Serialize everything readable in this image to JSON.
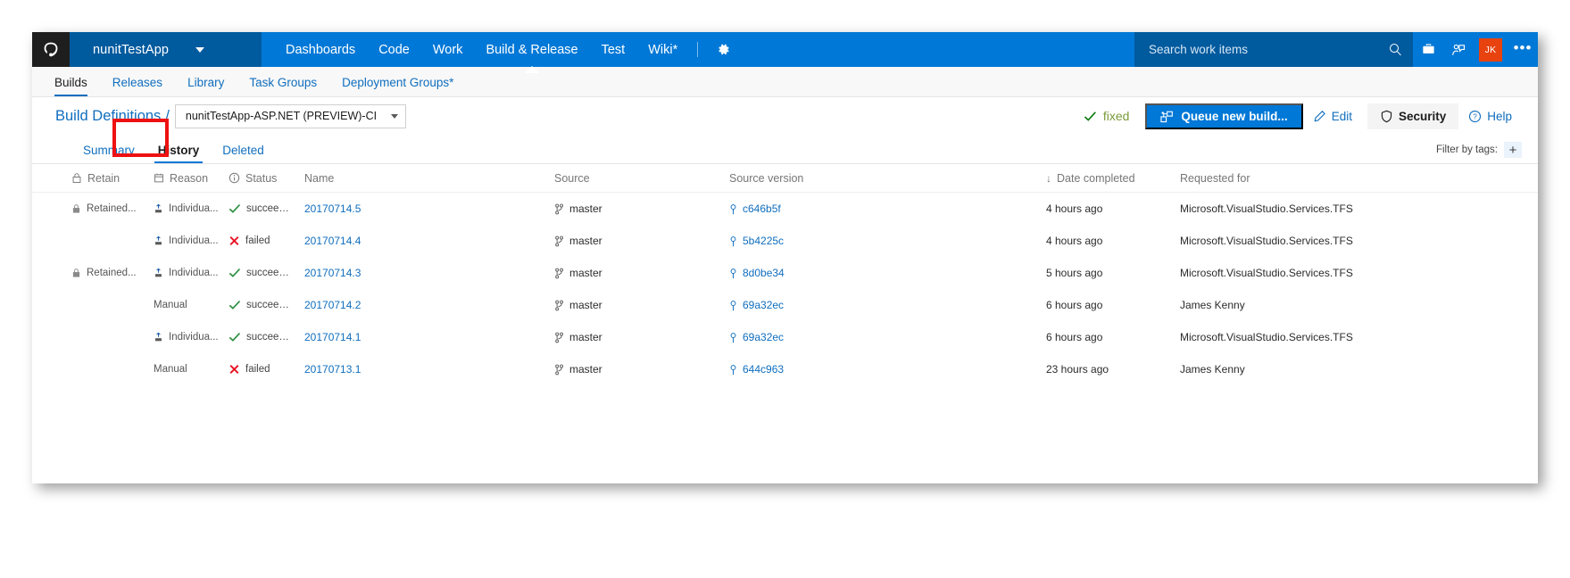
{
  "topbar": {
    "logo_icon": "azure-devops-logo-icon",
    "project_name": "nunitTestApp",
    "project_chevron_icon": "chevron-down-icon",
    "nav_items": [
      {
        "label": "Dashboards",
        "active": false
      },
      {
        "label": "Code",
        "active": false
      },
      {
        "label": "Work",
        "active": false
      },
      {
        "label": "Build & Release",
        "active": true
      },
      {
        "label": "Test",
        "active": false
      },
      {
        "label": "Wiki*",
        "active": false
      }
    ],
    "settings_icon": "gear-icon",
    "search": {
      "placeholder": "Search work items",
      "value": "",
      "icon": "search-icon"
    },
    "icons": [
      {
        "name": "marketplace-briefcase-icon"
      },
      {
        "name": "feedback-person-icon"
      }
    ],
    "avatar_initials": "JK",
    "avatar_color": "#e8430f",
    "more_label": "•••",
    "accent_color": "#0078d7",
    "project_bar_color": "#005a9e"
  },
  "hubnav": {
    "items": [
      {
        "label": "Builds",
        "active": true
      },
      {
        "label": "Releases",
        "active": false
      },
      {
        "label": "Library",
        "active": false
      },
      {
        "label": "Task Groups",
        "active": false
      },
      {
        "label": "Deployment Groups*",
        "active": false
      }
    ]
  },
  "breadcrumb": {
    "root_label": "Build Definitions",
    "separator": "/",
    "definition_name": "nunitTestApp-ASP.NET (PREVIEW)-CI",
    "picker_chevron_icon": "chevron-down-icon"
  },
  "toolbar": {
    "status_icon": "check-icon",
    "status_label": "fixed",
    "queue_icon": "queue-build-icon",
    "queue_label": "Queue new build...",
    "edit_icon": "pencil-icon",
    "edit_label": "Edit",
    "security_icon": "shield-icon",
    "security_label": "Security",
    "help_icon": "question-circle-icon",
    "help_label": "Help"
  },
  "pivots": {
    "items": [
      {
        "label": "Summary",
        "active": false
      },
      {
        "label": "History",
        "active": true
      },
      {
        "label": "Deleted",
        "active": false
      }
    ],
    "filter_label": "Filter by tags:",
    "filter_add_icon": "plus-icon",
    "annotation_color": "#ee1111"
  },
  "grid": {
    "columns": [
      {
        "label": "Retain",
        "icon": "lock-icon"
      },
      {
        "label": "Reason",
        "icon": "calendar-icon"
      },
      {
        "label": "Status",
        "icon": "info-circle-icon"
      },
      {
        "label": "Name",
        "icon": ""
      },
      {
        "label": "Source",
        "icon": ""
      },
      {
        "label": "Source version",
        "icon": ""
      },
      {
        "label": "Date completed",
        "icon": "sort-down-arrow-icon",
        "sorted": true
      },
      {
        "label": "Requested for",
        "icon": ""
      }
    ],
    "rows": [
      {
        "retain": "Retained...",
        "retain_icon": "lock-icon",
        "reason": "Individua...",
        "reason_icon": "upload-ci-icon",
        "status": "succee…",
        "status_icon": "check-icon",
        "status_state": "succeeded",
        "name": "20170714.5",
        "source": "master",
        "source_icon": "branch-icon",
        "version": "c646b5f",
        "version_icon": "commit-icon",
        "date": "4 hours ago",
        "requested_for": "Microsoft.VisualStudio.Services.TFS"
      },
      {
        "retain": "",
        "retain_icon": "",
        "reason": "Individua...",
        "reason_icon": "upload-ci-icon",
        "status": "failed",
        "status_icon": "x-icon",
        "status_state": "failed",
        "name": "20170714.4",
        "source": "master",
        "source_icon": "branch-icon",
        "version": "5b4225c",
        "version_icon": "commit-icon",
        "date": "4 hours ago",
        "requested_for": "Microsoft.VisualStudio.Services.TFS"
      },
      {
        "retain": "Retained...",
        "retain_icon": "lock-icon",
        "reason": "Individua...",
        "reason_icon": "upload-ci-icon",
        "status": "succee…",
        "status_icon": "check-icon",
        "status_state": "succeeded",
        "name": "20170714.3",
        "source": "master",
        "source_icon": "branch-icon",
        "version": "8d0be34",
        "version_icon": "commit-icon",
        "date": "5 hours ago",
        "requested_for": "Microsoft.VisualStudio.Services.TFS"
      },
      {
        "retain": "",
        "retain_icon": "",
        "reason": "Manual",
        "reason_icon": "",
        "status": "succee…",
        "status_icon": "check-icon",
        "status_state": "succeeded",
        "name": "20170714.2",
        "source": "master",
        "source_icon": "branch-icon",
        "version": "69a32ec",
        "version_icon": "commit-icon",
        "date": "6 hours ago",
        "requested_for": "James Kenny"
      },
      {
        "retain": "",
        "retain_icon": "",
        "reason": "Individua...",
        "reason_icon": "upload-ci-icon",
        "status": "succee…",
        "status_icon": "check-icon",
        "status_state": "succeeded",
        "name": "20170714.1",
        "source": "master",
        "source_icon": "branch-icon",
        "version": "69a32ec",
        "version_icon": "commit-icon",
        "date": "6 hours ago",
        "requested_for": "Microsoft.VisualStudio.Services.TFS"
      },
      {
        "retain": "",
        "retain_icon": "",
        "reason": "Manual",
        "reason_icon": "",
        "status": "failed",
        "status_icon": "x-icon",
        "status_state": "failed",
        "name": "20170713.1",
        "source": "master",
        "source_icon": "branch-icon",
        "version": "644c963",
        "version_icon": "commit-icon",
        "date": "23 hours ago",
        "requested_for": "James Kenny"
      }
    ]
  }
}
